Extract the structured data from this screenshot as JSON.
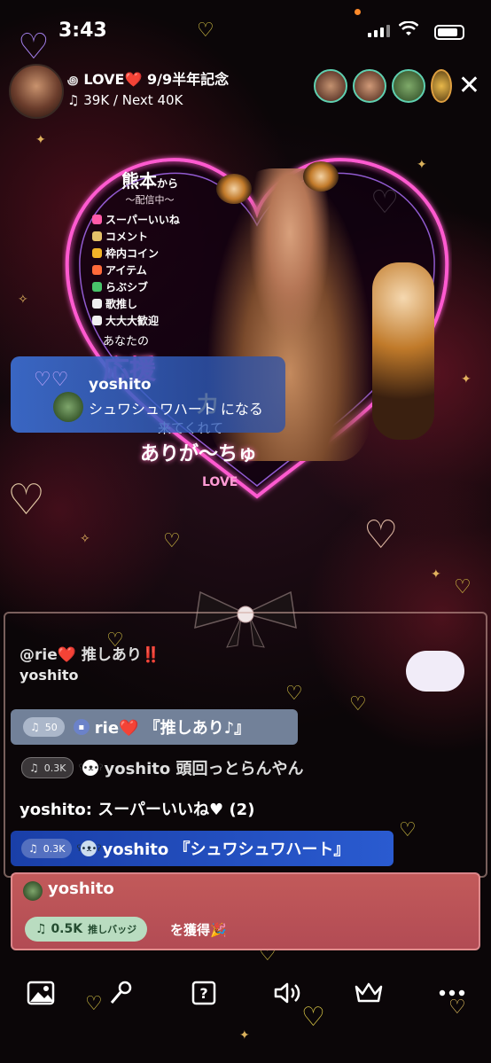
{
  "status_bar": {
    "time": "3:43"
  },
  "header": {
    "title": "LOVE❤️ 9/9半年記念",
    "followers": "39K / Next 40K"
  },
  "stream_card": {
    "from": "熊本",
    "from_suffix": "から",
    "subtitle": "～配信中～",
    "items": [
      "スーパーいいね",
      "コメント",
      "枠内コイン",
      "アイテム",
      "らぶシブ",
      "歌推し",
      "大大大歓迎"
    ],
    "item_colors": [
      "#ff5aa8",
      "#e5c26a",
      "#f2b428",
      "#ff6a3a",
      "#48c46a",
      "#f0f0f0",
      "#f0f0f0"
    ],
    "anata": "あなたの",
    "ouen": "応援",
    "chikara": "力",
    "kite": "来てくれて",
    "arigachu": "ありが～ちゅ",
    "love_tag": "LOVE"
  },
  "notification": {
    "name": "yoshito",
    "text": "シュワシュワハート になる"
  },
  "chat": {
    "cut_line": "@rie❤️ 推しあり‼️",
    "plain_name": "yoshito",
    "messages": [
      {
        "badge": "50",
        "text": "rie❤️ 『推しあり♪』"
      },
      {
        "badge": "0.3K",
        "text": "yoshito 頭回っとらんやん"
      },
      {
        "text": "yoshito: スーパーいいね♥ (2)"
      },
      {
        "badge": "0.3K",
        "text": "yoshito 『シュワシュワハート』"
      }
    ],
    "gift": {
      "name": "yoshito",
      "badge_value": "0.5K",
      "badge_label": "推しバッジ",
      "text": "を獲得🎉"
    }
  },
  "toolbar": {
    "icons": [
      "image-icon",
      "microphone-icon",
      "help-icon",
      "speaker-icon",
      "crown-icon",
      "more-icon"
    ]
  },
  "colors": {
    "accent_pink": "#ff4fb5",
    "chat_blue": "#1f4fc4",
    "chat_gray": "#7a8aa0",
    "gift_red": "#b84e56"
  }
}
